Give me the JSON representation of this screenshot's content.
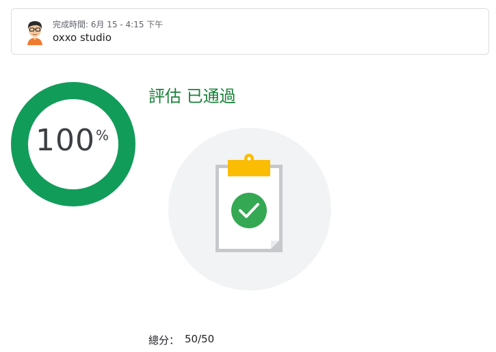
{
  "header": {
    "completion_time": "完成時間: 6月 15 - 4:15 下午",
    "user_name": "oxxo studio",
    "avatar_icon": "user-avatar-icon"
  },
  "score": {
    "value": "100",
    "unit": "%",
    "progress_fraction": 1.0,
    "ring_color": "#129c5a"
  },
  "status": {
    "title": "評估 已通過",
    "color": "#188038",
    "illustration_icon": "clipboard-check-icon"
  },
  "total": {
    "label": "總分：",
    "value": "50/50"
  }
}
